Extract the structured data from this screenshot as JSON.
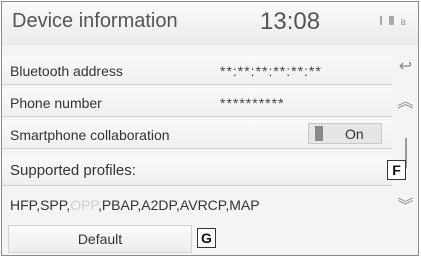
{
  "header": {
    "title": "Device information",
    "time": "13:08"
  },
  "rows": {
    "bluetooth_address": {
      "label": "Bluetooth address",
      "value": "**:**:**:**:**:**"
    },
    "phone_number": {
      "label": "Phone number",
      "value": "**********"
    },
    "smartphone_collaboration": {
      "label": "Smartphone collaboration",
      "toggle": "On"
    },
    "supported_profiles": {
      "label": "Supported profiles:"
    }
  },
  "profiles": {
    "part1": "HFP,SPP,",
    "dim": "OPP",
    "part2": ",PBAP,A2DP,AVRCP,MAP"
  },
  "callouts": {
    "f": "F",
    "g": "G"
  },
  "default_button": "Default",
  "icons": {
    "back": "back-arrow-icon",
    "up": "double-chevron-up-icon",
    "down": "double-chevron-down-icon"
  }
}
